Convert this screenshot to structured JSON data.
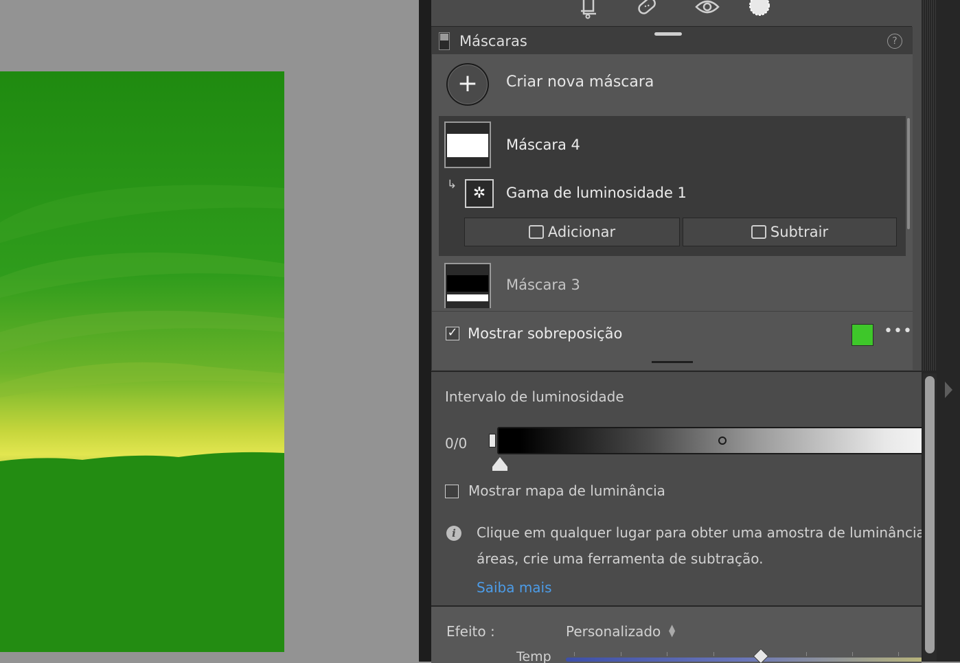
{
  "masks_panel": {
    "title": "Máscaras",
    "help": "?",
    "create_label": "Criar nova máscara",
    "create_icon": "+",
    "masks": [
      {
        "label": "Máscara 4",
        "selected": true,
        "components": [
          {
            "label": "Gama de luminosidade 1"
          }
        ]
      },
      {
        "label": "Máscara 3",
        "selected": false
      }
    ],
    "add_label": "Adicionar",
    "subtract_label": "Subtrair",
    "show_overlay_label": "Mostrar sobreposição",
    "show_overlay_checked": true,
    "overlay_color": "#3ec72a",
    "more": "•••"
  },
  "luminance_range": {
    "title": "Intervalo de luminosidade",
    "value": "0/0",
    "show_luminance_map_label": "Mostrar mapa de luminância",
    "show_luminance_map_checked": false,
    "info_line1": "Clique em qualquer lugar para obter uma amostra de luminância. P",
    "info_line2": "áreas, crie uma ferramenta de subtração.",
    "learn_more": "Saiba mais"
  },
  "effect": {
    "label": "Efeito :",
    "value": "Personalizado",
    "temp_label": "Temp"
  },
  "icons": [
    "crop-icon",
    "heal-icon",
    "red-eye-icon",
    "masking-icon"
  ]
}
